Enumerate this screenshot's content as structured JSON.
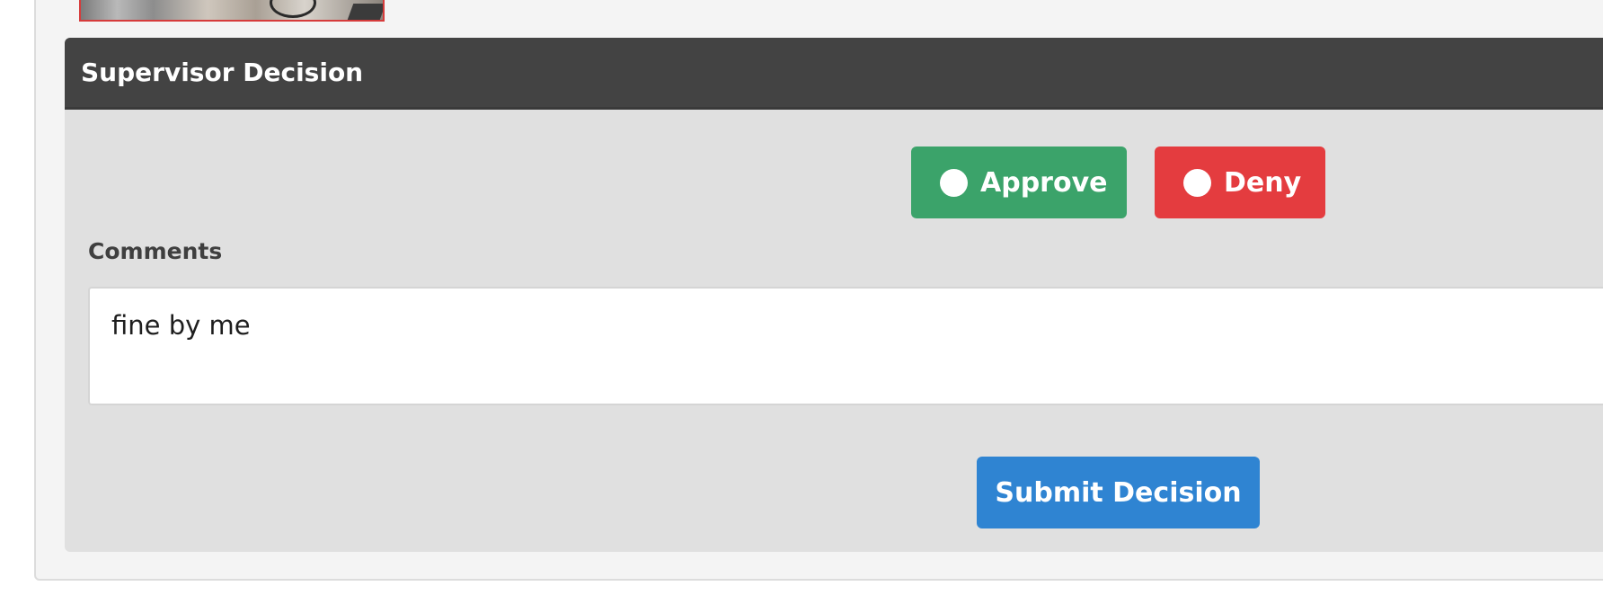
{
  "panel": {
    "title": "Supervisor Decision"
  },
  "decision": {
    "approve_label": "Approve",
    "deny_label": "Deny",
    "approve_color": "#3ba36a",
    "deny_color": "#e43c3f"
  },
  "comments": {
    "label": "Comments",
    "value": "fine by me"
  },
  "actions": {
    "submit_label": "Submit Decision",
    "submit_color": "#2f84d2"
  }
}
